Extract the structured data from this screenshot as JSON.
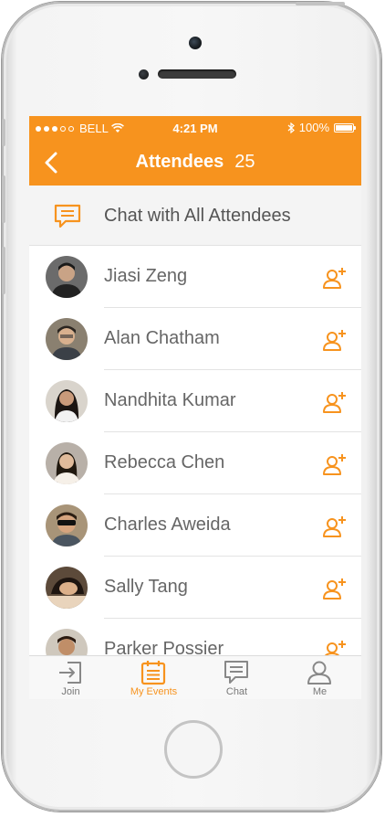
{
  "status_bar": {
    "carrier": "BELL",
    "time": "4:21 PM",
    "battery": "100%",
    "battery_level": 1.0,
    "signal_bars_filled": 3,
    "signal_bars_total": 5
  },
  "header": {
    "title": "Attendees",
    "count": "25"
  },
  "chat_all": {
    "label": "Chat with All Attendees"
  },
  "attendees": [
    {
      "name": "Jiasi Zeng"
    },
    {
      "name": "Alan Chatham"
    },
    {
      "name": "Nandhita Kumar"
    },
    {
      "name": "Rebecca Chen"
    },
    {
      "name": "Charles Aweida"
    },
    {
      "name": "Sally Tang"
    },
    {
      "name": "Parker Possier"
    }
  ],
  "tabs": [
    {
      "label": "Join",
      "icon": "join-icon",
      "active": false
    },
    {
      "label": "My Events",
      "icon": "calendar-icon",
      "active": true
    },
    {
      "label": "Chat",
      "icon": "chat-icon",
      "active": false
    },
    {
      "label": "Me",
      "icon": "person-icon",
      "active": false
    }
  ],
  "colors": {
    "accent": "#f7931e",
    "text_secondary": "#666666",
    "tab_inactive": "#777777"
  }
}
